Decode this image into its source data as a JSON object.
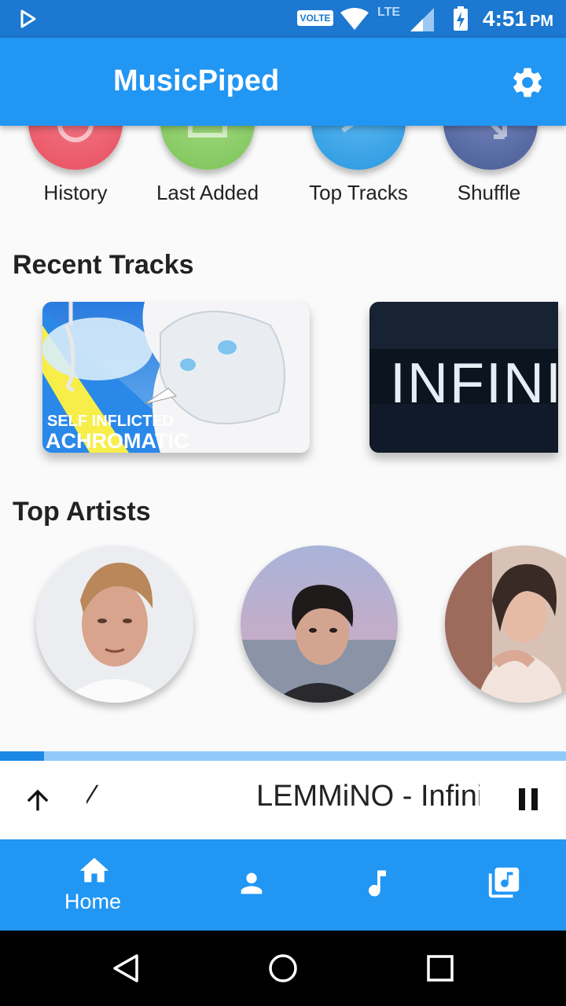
{
  "status_bar": {
    "volte": "VOLTE",
    "network": "LTE",
    "time": "4:51",
    "ampm": "PM"
  },
  "app_bar": {
    "title": "MusicPiped",
    "settings_icon": "gear-icon"
  },
  "quick_actions": [
    {
      "label": "History",
      "icon": "history-icon",
      "color": "#ef5f73"
    },
    {
      "label": "Last Added",
      "icon": "library-icon",
      "color": "#8fd16a"
    },
    {
      "label": "Top Tracks",
      "icon": "trending-icon",
      "color": "#42a8ea"
    },
    {
      "label": "Shuffle",
      "icon": "shuffle-icon",
      "color": "#5b6fa8"
    }
  ],
  "recent_tracks": {
    "title": "Recent Tracks",
    "items": [
      {
        "art_text_line1": "SELF INFLICTED",
        "art_text_line2": "ACHROMATIC"
      },
      {
        "art_text": "INFINIT"
      }
    ]
  },
  "top_artists": {
    "title": "Top Artists"
  },
  "mini_player": {
    "now_playing": "LEMMiNO - Infinite",
    "progress": 0.078,
    "expand_icon": "arrow-up-icon",
    "pause_icon": "pause-icon"
  },
  "bottom_nav": {
    "items": [
      {
        "label": "Home",
        "icon": "home-icon",
        "active": true
      },
      {
        "label": "",
        "icon": "person-icon"
      },
      {
        "label": "",
        "icon": "music-note-icon"
      },
      {
        "label": "",
        "icon": "library-music-icon"
      }
    ]
  },
  "colors": {
    "primary": "#2196f3",
    "status_bar": "#1c78d0"
  }
}
